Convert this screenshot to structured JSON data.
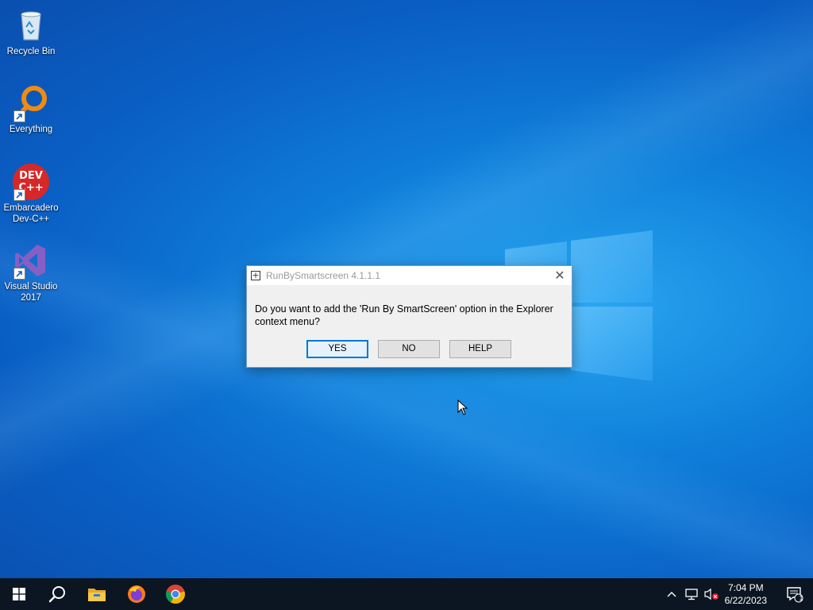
{
  "desktop": {
    "icons": [
      {
        "label_lines": [
          "Recycle Bin"
        ],
        "icon": "recycle-bin-icon"
      },
      {
        "label_lines": [
          "Everything"
        ],
        "icon": "everything-search-icon"
      },
      {
        "label_lines": [
          "Embarcadero",
          "Dev-C++"
        ],
        "icon": "devcpp-icon",
        "logo_text": "DEV C++"
      },
      {
        "label_lines": [
          "Visual Studio",
          "2017"
        ],
        "icon": "visual-studio-icon"
      }
    ]
  },
  "dialog": {
    "title": "RunBySmartscreen 4.1.1.1",
    "message": "Do you want to add the 'Run By SmartScreen' option in the Explorer context menu?",
    "buttons": {
      "yes": "YES",
      "no": "NO",
      "help": "HELP"
    },
    "default_button": "yes"
  },
  "taskbar": {
    "apps": [
      "start-icon",
      "search-icon",
      "file-explorer-icon",
      "firefox-icon",
      "chrome-icon"
    ],
    "tray": {
      "icons": [
        "chevron-up-icon",
        "network-icon",
        "volume-muted-icon"
      ]
    },
    "clock": {
      "time": "7:04 PM",
      "date": "6/22/2023"
    },
    "notification_count": "1"
  },
  "colors": {
    "accent": "#0078d7",
    "taskbar": "#0b1622"
  }
}
